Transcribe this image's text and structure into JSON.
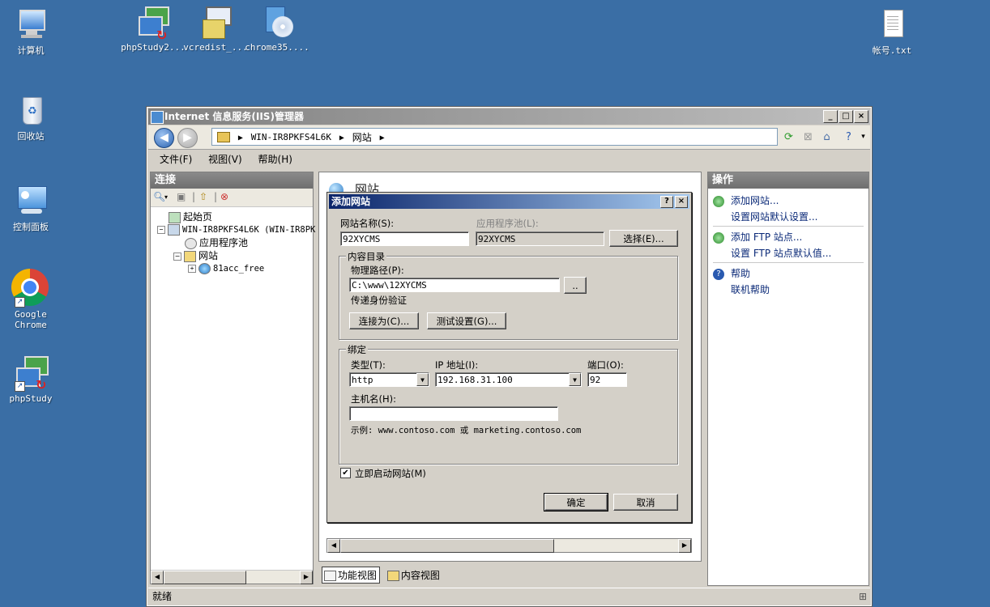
{
  "desktop": {
    "icons": [
      {
        "label": "计算机",
        "icon": "computer-icon"
      },
      {
        "label": "phpStudy2...",
        "icon": "phpstudy-icon"
      },
      {
        "label": "vcredist_...",
        "icon": "installer-icon"
      },
      {
        "label": "chrome35....",
        "icon": "installer-disc-icon"
      },
      {
        "label": "帐号.txt",
        "icon": "text-file-icon"
      },
      {
        "label": "回收站",
        "icon": "recycle-bin-icon"
      },
      {
        "label": "控制面板",
        "icon": "control-panel-icon"
      },
      {
        "label": "Google Chrome",
        "icon": "chrome-icon"
      },
      {
        "label": "phpStudy",
        "icon": "phpstudy-icon"
      }
    ]
  },
  "window": {
    "title": "Internet 信息服务(IIS)管理器",
    "breadcrumb": [
      "WIN-IR8PKFS4L6K",
      "网站"
    ],
    "menu": [
      "文件(F)",
      "视图(V)",
      "帮助(H)"
    ],
    "status": "就绪"
  },
  "connections": {
    "header": "连接",
    "tree": [
      {
        "label": "起始页"
      },
      {
        "label": "WIN-IR8PKFS4L6K (WIN-IR8PK"
      },
      {
        "label": "应用程序池"
      },
      {
        "label": "网站"
      },
      {
        "label": "81acc_free"
      }
    ]
  },
  "center": {
    "title": "网站",
    "tabs": [
      "功能视图",
      "内容视图"
    ]
  },
  "actions": {
    "header": "操作",
    "items": [
      "添加网站...",
      "设置网站默认设置...",
      "添加 FTP 站点...",
      "设置 FTP 站点默认值...",
      "帮助",
      "联机帮助"
    ]
  },
  "dialog": {
    "title": "添加网站",
    "site_name_label": "网站名称(S):",
    "site_name_value": "92XYCMS",
    "app_pool_label": "应用程序池(L):",
    "app_pool_value": "92XYCMS",
    "select_button": "选择(E)...",
    "content_group": "内容目录",
    "physical_path_label": "物理路径(P):",
    "physical_path_value": "C:\\www\\12XYCMS",
    "browse_button": "..",
    "pass_auth_label": "传递身份验证",
    "connect_as_button": "连接为(C)...",
    "test_settings_button": "测试设置(G)...",
    "binding_group": "绑定",
    "type_label": "类型(T):",
    "type_value": "http",
    "ip_label": "IP 地址(I):",
    "ip_value": "192.168.31.100",
    "port_label": "端口(O):",
    "port_value": "92",
    "host_label": "主机名(H):",
    "host_value": "",
    "example": "示例: www.contoso.com 或 marketing.contoso.com",
    "start_label": "立即启动网站(M)",
    "start_checked": "✔",
    "ok_button": "确定",
    "cancel_button": "取消"
  }
}
